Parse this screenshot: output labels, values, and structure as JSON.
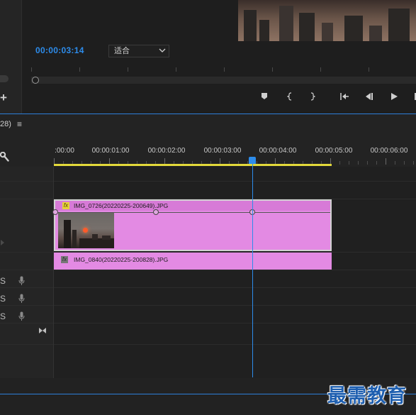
{
  "monitor": {
    "timecode": "00:00:03:14",
    "fit_value": "适合"
  },
  "timeline": {
    "tab_label": "28)",
    "menu_glyph": "≡",
    "ruler_labels": [
      ":00:00",
      "00:00:01:00",
      "00:00:02:00",
      "00:00:03:00",
      "00:00:04:00",
      "00:00:05:00",
      "00:00:06:00"
    ],
    "playhead_time": "00:00:03:14"
  },
  "clips": {
    "v2": {
      "name": "IMG_0726(20220225-200649).JPG",
      "fx": "fx",
      "fx_color": "#e6d33a"
    },
    "v1": {
      "name": "IMG_0840(20220225-200828).JPG",
      "fx": "fx",
      "fx_color": "#777777"
    }
  },
  "audio_tracks": [
    {
      "label": "S"
    },
    {
      "label": "S"
    },
    {
      "label": "S"
    }
  ],
  "icons": [
    "wrench-icon",
    "marker-icon",
    "mark-in-icon",
    "mark-out-icon",
    "go-to-in-icon",
    "step-back-icon",
    "play-icon",
    "expand-arrow-icon",
    "microphone-icon",
    "bowtie-icon",
    "menu-icon",
    "chevron-down-icon"
  ],
  "colors": {
    "accent": "#2d8ceb",
    "clip": "#e38ae3",
    "work_area": "#e3d93a"
  },
  "watermark": "最需教育"
}
